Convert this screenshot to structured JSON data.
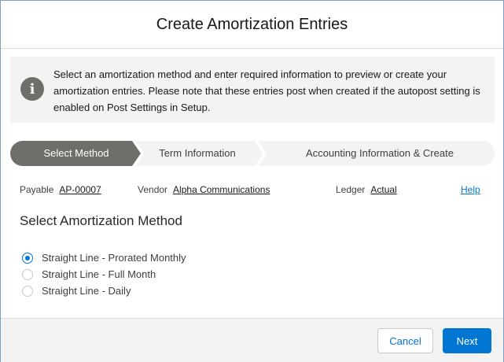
{
  "modal": {
    "title": "Create Amortization Entries"
  },
  "alert": {
    "icon": "info-icon",
    "message": "Select an amortization method and enter required information to preview or create your amortization entries. Please note that these entries post when created if the autopost setting is enabled on Post Settings in Setup."
  },
  "path": {
    "steps": [
      {
        "label": "Select Method",
        "active": true
      },
      {
        "label": "Term Information",
        "active": false
      },
      {
        "label": "Accounting Information & Create",
        "active": false
      }
    ],
    "colors": {
      "active": "#706e6b",
      "inactive": "#f3f3f3"
    }
  },
  "details": {
    "payable_label": "Payable",
    "payable_value": "AP-00007",
    "vendor_label": "Vendor",
    "vendor_value": "Alpha Communications",
    "ledger_label": "Ledger",
    "ledger_value": "Actual",
    "help_link": "Help"
  },
  "section": {
    "title": "Select Amortization Method",
    "options": [
      {
        "label": "Straight Line - Prorated Monthly",
        "selected": true
      },
      {
        "label": "Straight Line - Full Month",
        "selected": false
      },
      {
        "label": "Straight Line - Daily",
        "selected": false
      }
    ]
  },
  "footer": {
    "cancel_label": "Cancel",
    "next_label": "Next",
    "brand_color": "#0176d3"
  }
}
